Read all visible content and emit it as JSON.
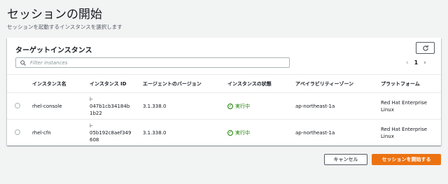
{
  "page": {
    "title": "セッションの開始",
    "description": "セッションを起動するインスタンスを選択します"
  },
  "card": {
    "title": "ターゲットインスタンス",
    "search_placeholder": "Filter instances",
    "pagination": {
      "current_page": "1"
    }
  },
  "table": {
    "headers": [
      "インスタンス名",
      "インスタンス ID",
      "エージェントのバージョン",
      "インスタンスの状態",
      "アベイラビリティーゾーン",
      "プラットフォーム"
    ],
    "rows": [
      {
        "name": "rhel-console",
        "id_lines": [
          "i-",
          "047b1cb34184b",
          "1b22"
        ],
        "agent_version": "3.1.338.0",
        "state": "実行中",
        "az": "ap-northeast-1a",
        "platform": "Red Hat Enterprise Linux"
      },
      {
        "name": "rhel-cfn",
        "id_lines": [
          "i-",
          "05b192c8aef349",
          "608"
        ],
        "agent_version": "3.1.338.0",
        "state": "実行中",
        "az": "ap-northeast-1a",
        "platform": "Red Hat Enterprise Linux"
      }
    ]
  },
  "actions": {
    "cancel_label": "キャンセル",
    "start_label": "セッションを開始する"
  },
  "colors": {
    "primary": "#ec7211",
    "success": "#1d8102",
    "background": "#f2f3f3"
  }
}
